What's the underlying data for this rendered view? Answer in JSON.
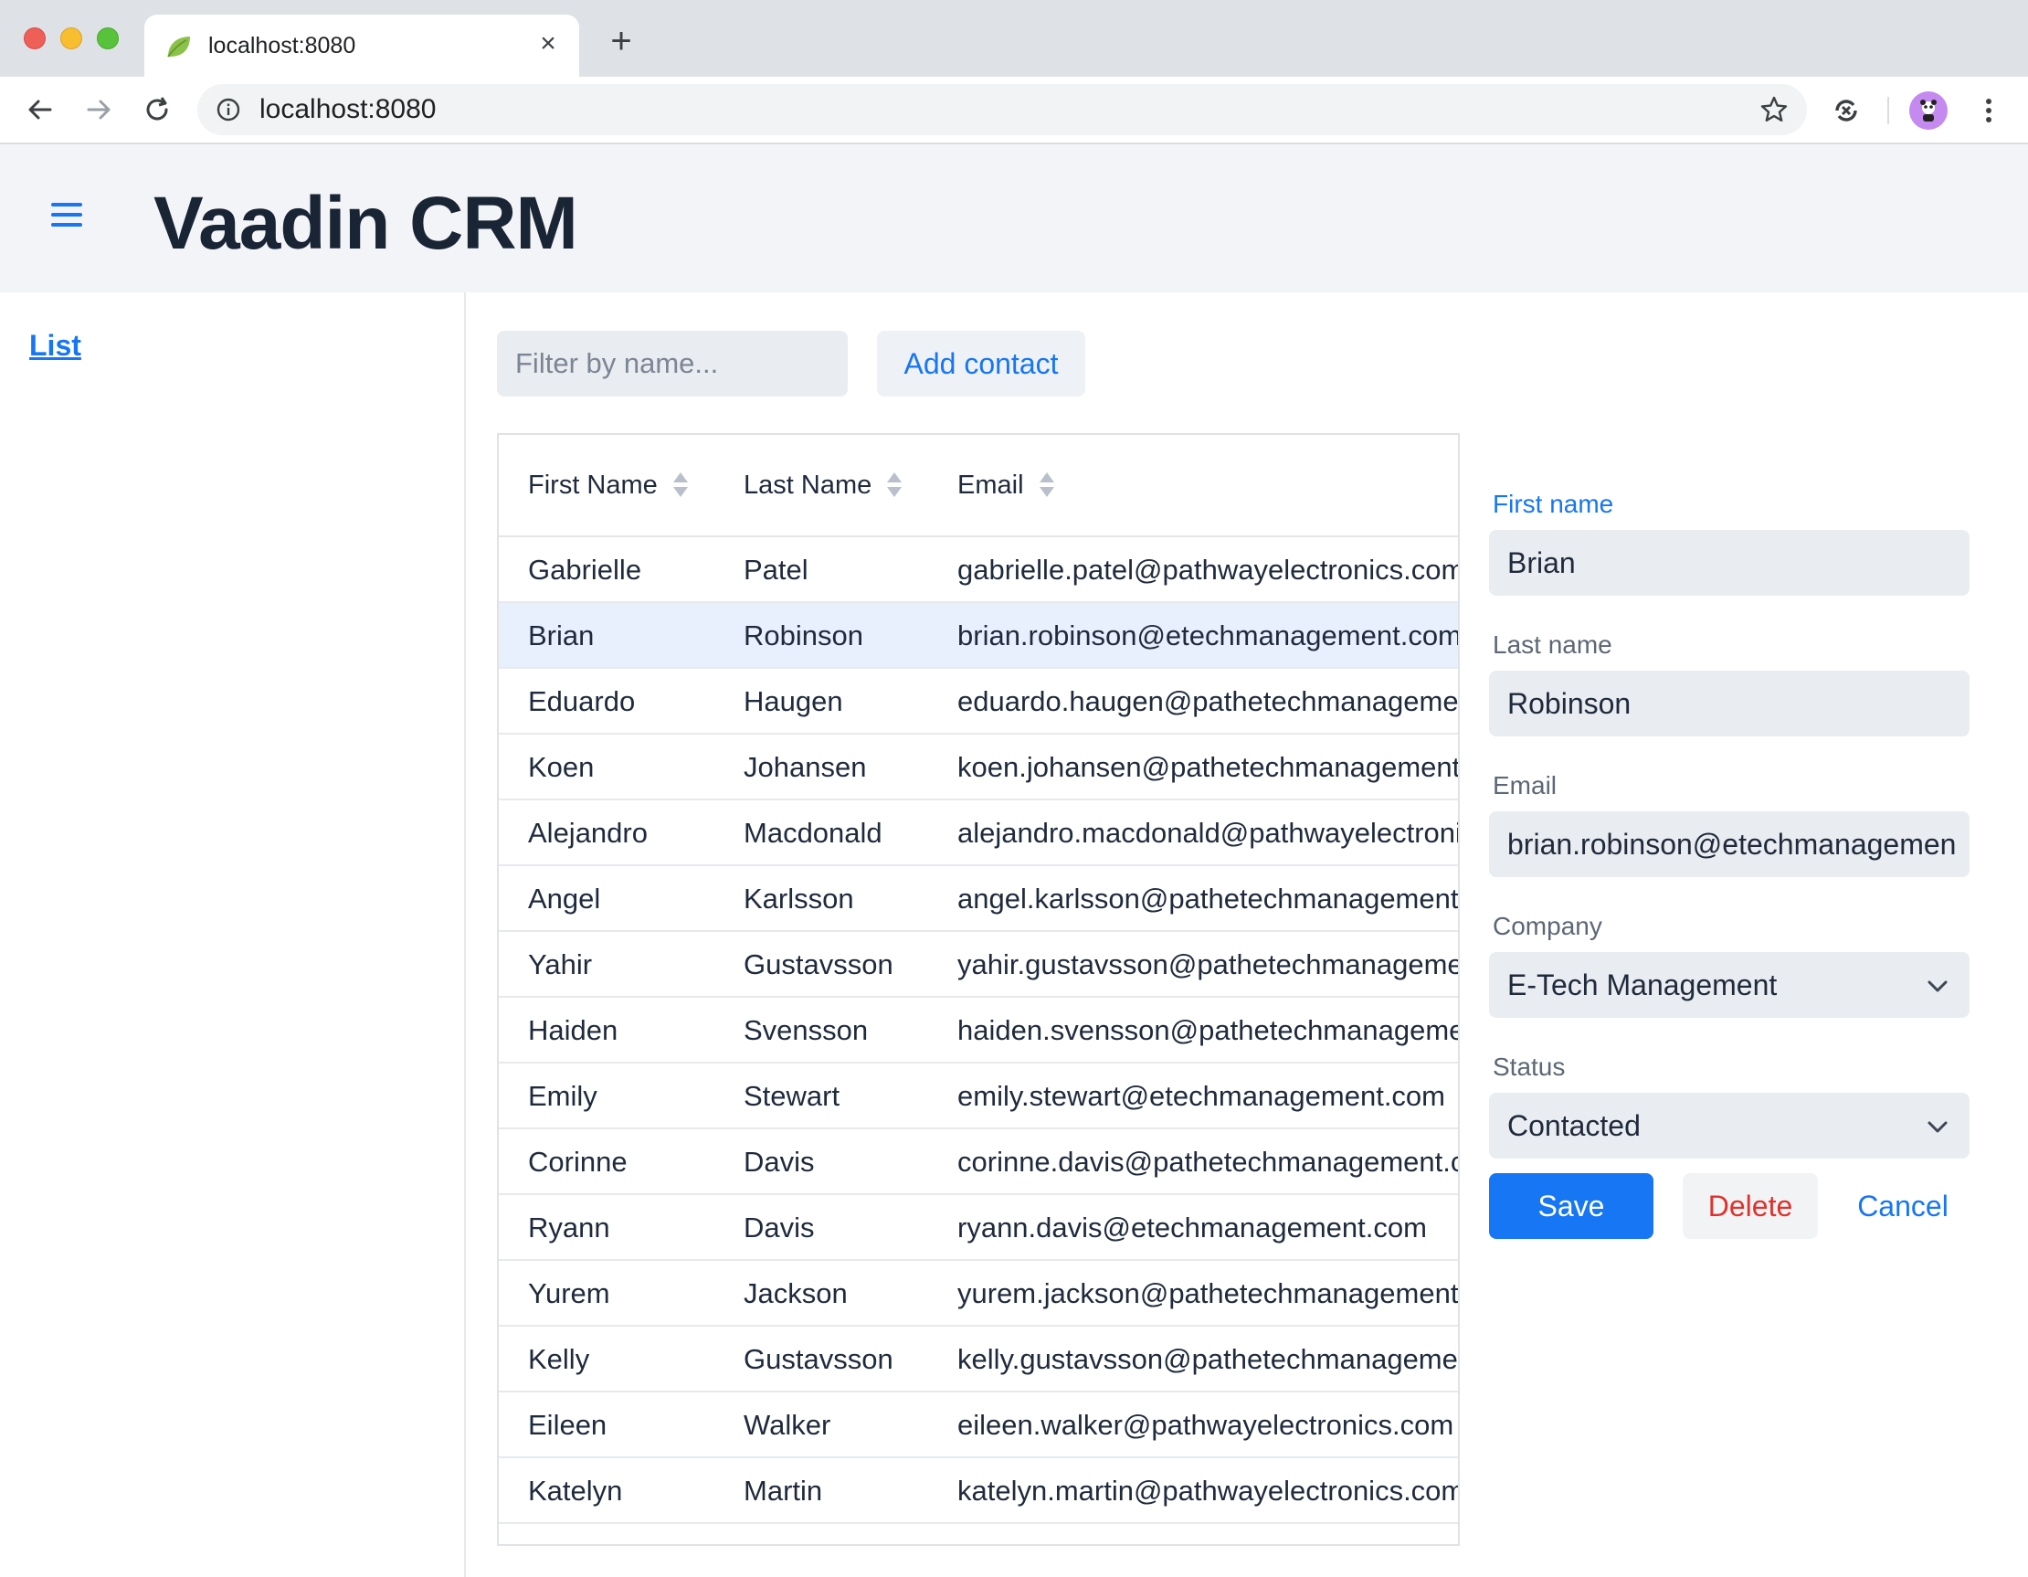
{
  "browser": {
    "tab_title": "localhost:8080",
    "url": "localhost:8080",
    "colors": {
      "tab_bar": "#dee1e6",
      "omnibox": "#f1f3f4"
    }
  },
  "app": {
    "title": "Vaadin CRM",
    "accent_color": "#1676f3",
    "drawer": {
      "links": [
        {
          "label": "List"
        }
      ]
    }
  },
  "toolbar": {
    "filter_placeholder": "Filter by name...",
    "add_contact_label": "Add contact"
  },
  "grid": {
    "columns": [
      "First Name",
      "Last Name",
      "Email"
    ],
    "selected_index": 1,
    "rows": [
      {
        "first": "Gabrielle",
        "last": "Patel",
        "email": "gabrielle.patel@pathwayelectronics.com"
      },
      {
        "first": "Brian",
        "last": "Robinson",
        "email": "brian.robinson@etechmanagement.com"
      },
      {
        "first": "Eduardo",
        "last": "Haugen",
        "email": "eduardo.haugen@pathetechmanageme"
      },
      {
        "first": "Koen",
        "last": "Johansen",
        "email": "koen.johansen@pathetechmanagement"
      },
      {
        "first": "Alejandro",
        "last": "Macdonald",
        "email": "alejandro.macdonald@pathwayelectroni"
      },
      {
        "first": "Angel",
        "last": "Karlsson",
        "email": "angel.karlsson@pathetechmanagement"
      },
      {
        "first": "Yahir",
        "last": "Gustavsson",
        "email": "yahir.gustavsson@pathetechmanageme"
      },
      {
        "first": "Haiden",
        "last": "Svensson",
        "email": "haiden.svensson@pathetechmanageme"
      },
      {
        "first": "Emily",
        "last": "Stewart",
        "email": "emily.stewart@etechmanagement.com"
      },
      {
        "first": "Corinne",
        "last": "Davis",
        "email": "corinne.davis@pathetechmanagement.c"
      },
      {
        "first": "Ryann",
        "last": "Davis",
        "email": "ryann.davis@etechmanagement.com"
      },
      {
        "first": "Yurem",
        "last": "Jackson",
        "email": "yurem.jackson@pathetechmanagement"
      },
      {
        "first": "Kelly",
        "last": "Gustavsson",
        "email": "kelly.gustavsson@pathetechmanagemer"
      },
      {
        "first": "Eileen",
        "last": "Walker",
        "email": "eileen.walker@pathwayelectronics.com"
      },
      {
        "first": "Katelyn",
        "last": "Martin",
        "email": "katelyn.martin@pathwayelectronics.com"
      }
    ]
  },
  "form": {
    "first_name": {
      "label": "First name",
      "value": "Brian"
    },
    "last_name": {
      "label": "Last name",
      "value": "Robinson"
    },
    "email": {
      "label": "Email",
      "value": "brian.robinson@etechmanagemen"
    },
    "company": {
      "label": "Company",
      "value": "E-Tech Management"
    },
    "status": {
      "label": "Status",
      "value": "Contacted"
    },
    "buttons": {
      "save": "Save",
      "delete": "Delete",
      "cancel": "Cancel"
    },
    "colors": {
      "save_bg": "#1676f3",
      "delete_text": "#e0312c"
    }
  }
}
